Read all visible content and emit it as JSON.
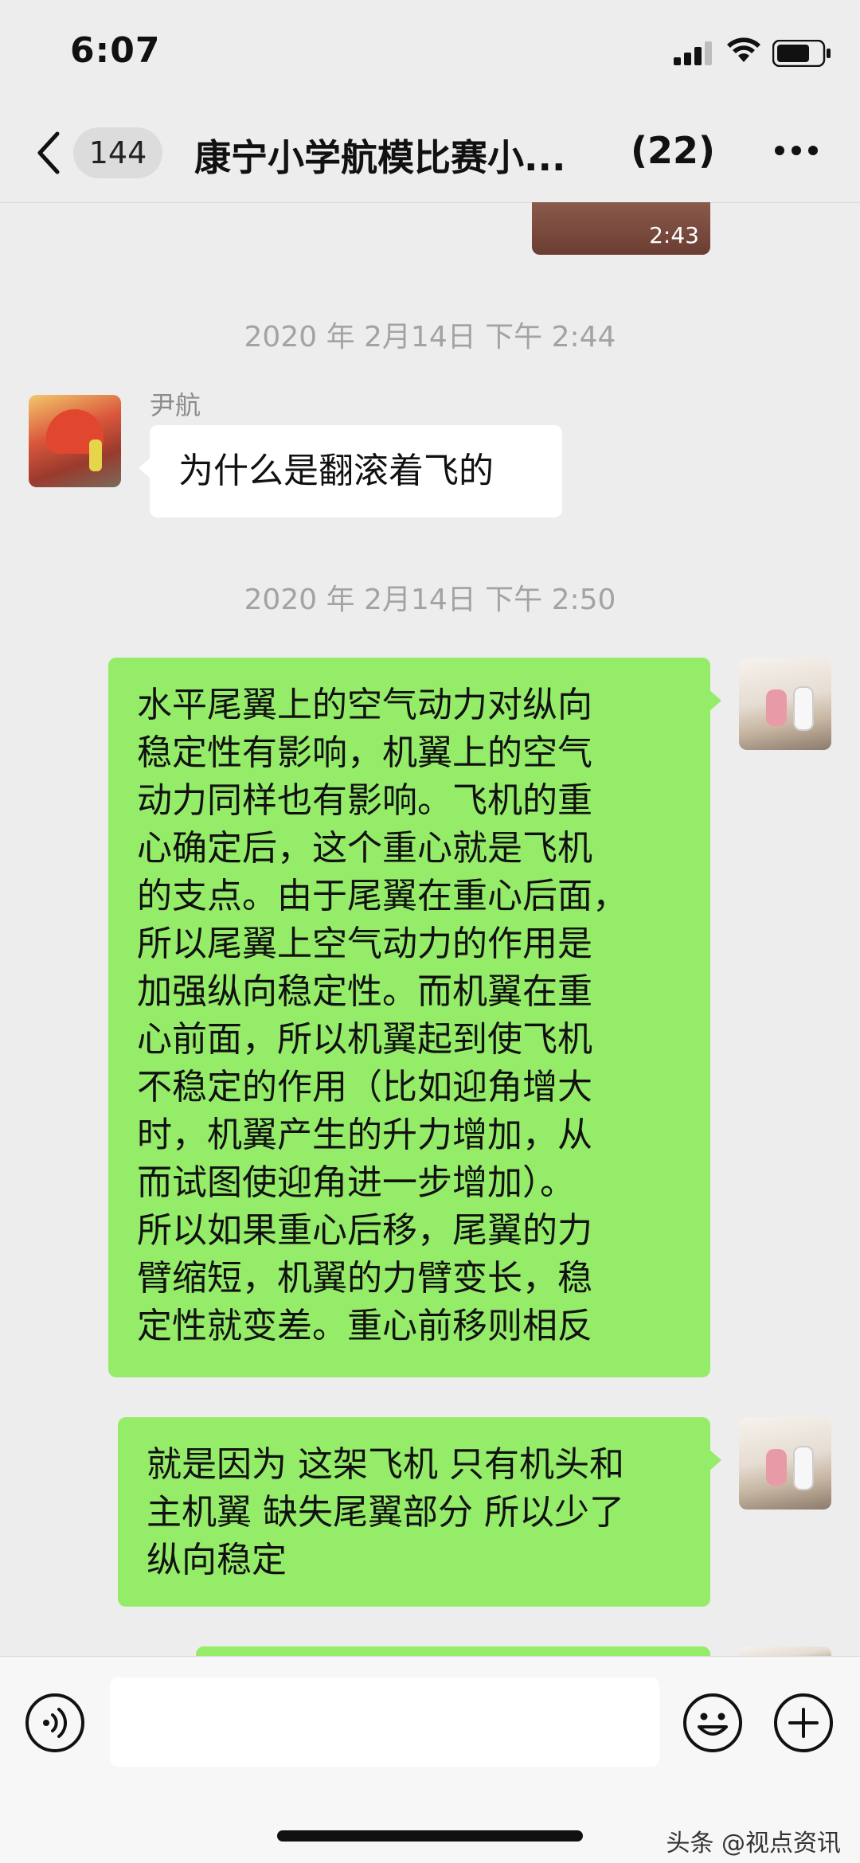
{
  "status_bar": {
    "time": "6:07"
  },
  "header": {
    "unread_count": "144",
    "title": "康宁小学航模比赛小...",
    "member_count": "(22)"
  },
  "messages": {
    "video": {
      "duration": "2:43"
    },
    "timestamp_1": "2020 年 2月14日 下午 2:44",
    "msg_1": {
      "sender": "尹航",
      "text": "为什么是翻滚着飞的"
    },
    "timestamp_2": "2020 年 2月14日 下午 2:50",
    "msg_2": {
      "text": "水平尾翼上的空气动力对纵向\n稳定性有影响，机翼上的空气\n动力同样也有影响。飞机的重\n心确定后，这个重心就是飞机\n的支点。由于尾翼在重心后面，\n所以尾翼上空气动力的作用是\n加强纵向稳定性。而机翼在重\n心前面，所以机翼起到使飞机\n不稳定的作用（比如迎角增大\n时，机翼产生的升力增加，从\n而试图使迎角进一步增加）。\n所以如果重心后移，尾翼的力\n臂缩短，机翼的力臂变长，稳\n定性就变差。重心前移则相反"
    },
    "msg_3": {
      "text": "就是因为 这架飞机 只有机头和\n主机翼 缺失尾翼部分 所以少了\n纵向稳定"
    }
  },
  "input_bar": {
    "placeholder": ""
  },
  "watermark": "头条 @视点资讯",
  "colors": {
    "background": "#ededed",
    "own_bubble": "#95ec69",
    "other_bubble": "#ffffff"
  },
  "icons": {
    "status": [
      "signal-icon",
      "wifi-icon",
      "battery-icon"
    ],
    "header": [
      "back-icon",
      "more-icon"
    ],
    "input": [
      "voice-icon",
      "emoji-icon",
      "plus-icon"
    ]
  }
}
